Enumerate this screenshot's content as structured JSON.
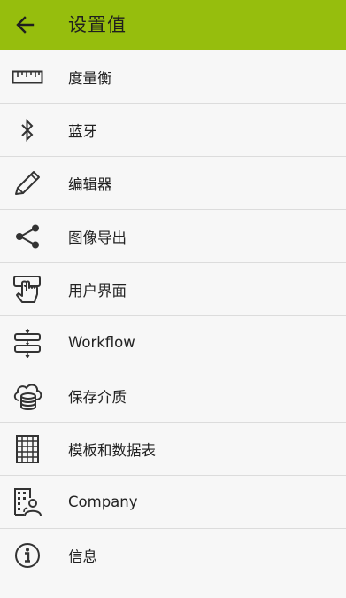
{
  "appbar": {
    "title": "设置值",
    "back_icon": "arrow-back-icon",
    "color": "#96be0d"
  },
  "menu": {
    "items": [
      {
        "label": "度量衡",
        "icon": "ruler-icon"
      },
      {
        "label": "蓝牙",
        "icon": "bluetooth-icon"
      },
      {
        "label": "编辑器",
        "icon": "pencil-icon"
      },
      {
        "label": "图像导出",
        "icon": "share-icon"
      },
      {
        "label": "用户界面",
        "icon": "touch-icon"
      },
      {
        "label": "Workflow",
        "icon": "workflow-icon"
      },
      {
        "label": "保存介质",
        "icon": "cloud-storage-icon"
      },
      {
        "label": "模板和数据表",
        "icon": "grid-table-icon"
      },
      {
        "label": "Company",
        "icon": "company-icon"
      },
      {
        "label": "信息",
        "icon": "info-icon"
      }
    ]
  }
}
